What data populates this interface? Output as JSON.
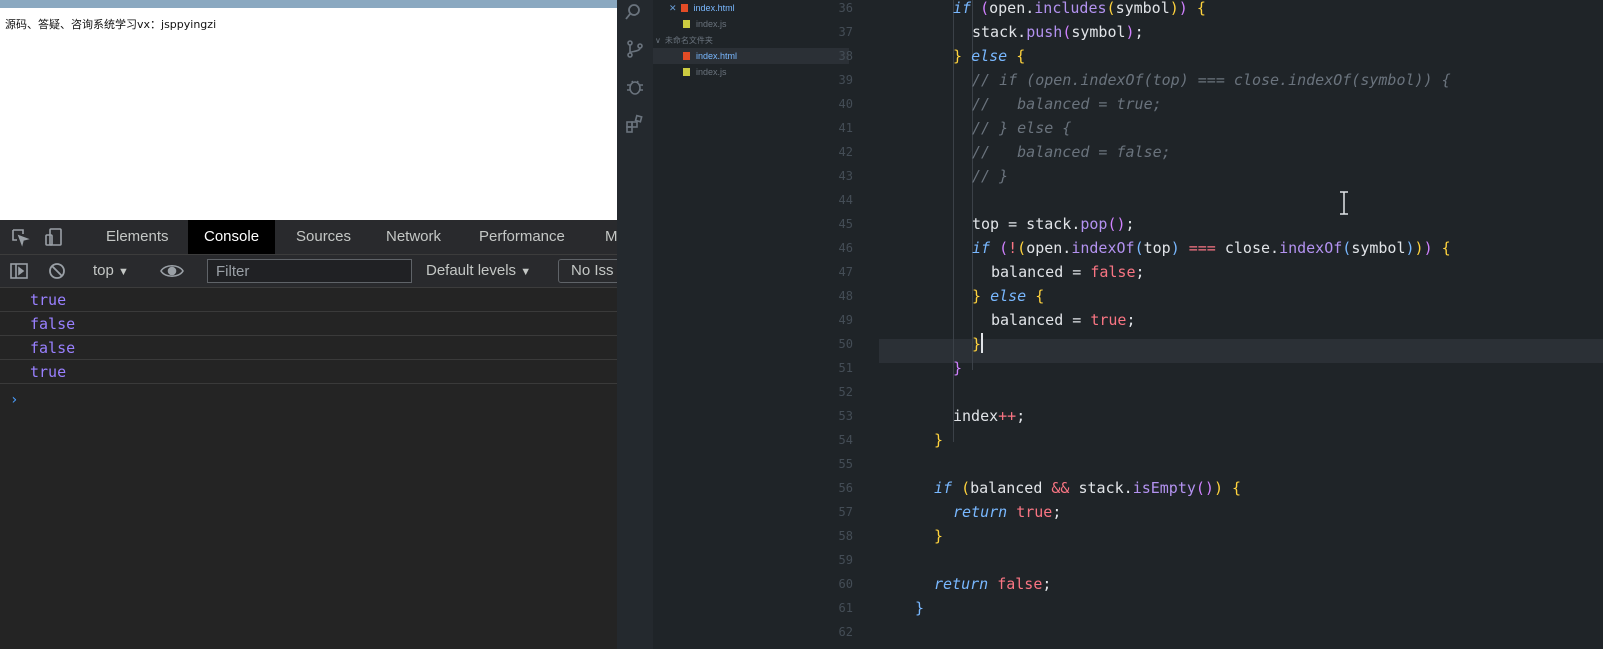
{
  "browser": {
    "page_text": "源码、答疑、咨询系统学习vx：jsppyingzi"
  },
  "devtools": {
    "tabs": [
      {
        "label": "Elements"
      },
      {
        "label": "Console"
      },
      {
        "label": "Sources"
      },
      {
        "label": "Network"
      },
      {
        "label": "Performance"
      },
      {
        "label": "M"
      }
    ],
    "active_tab": "Console",
    "toolbar": {
      "context": "top",
      "filter_placeholder": "Filter",
      "levels": "Default levels",
      "issues": "No Iss"
    },
    "console": {
      "messages": [
        "true",
        "false",
        "false",
        "true"
      ],
      "prompt": "›"
    }
  },
  "explorer": {
    "folder_label": "未命名文件夹",
    "files": [
      {
        "name": "index.html",
        "icon": "html-file-icon",
        "color": "#e34c26",
        "active": true,
        "closable": true
      },
      {
        "name": "index.js",
        "icon": "js-file-icon",
        "color": "#cbcb41"
      },
      {
        "name": "index.html",
        "icon": "html-file-icon",
        "color": "#e34c26",
        "selected": true
      },
      {
        "name": "index.js",
        "icon": "js-file-icon",
        "color": "#cbcb41"
      }
    ]
  },
  "editor": {
    "line_numbers": [
      "36",
      "37",
      "38",
      "39",
      "40",
      "41",
      "42",
      "43",
      "44",
      "45",
      "46",
      "47",
      "48",
      "49",
      "50",
      "51",
      "52",
      "53",
      "54",
      "55",
      "56",
      "57",
      "58",
      "59",
      "60",
      "61",
      "62"
    ],
    "current_line": 50,
    "colors": {
      "keyword": "#79b8ff",
      "function": "#b392f0",
      "string": "#9ecbff",
      "constant": "#f97583",
      "comment": "#6a737d",
      "bracket_yellow": "#ffd33d",
      "bracket_purple": "#d081ff"
    }
  }
}
